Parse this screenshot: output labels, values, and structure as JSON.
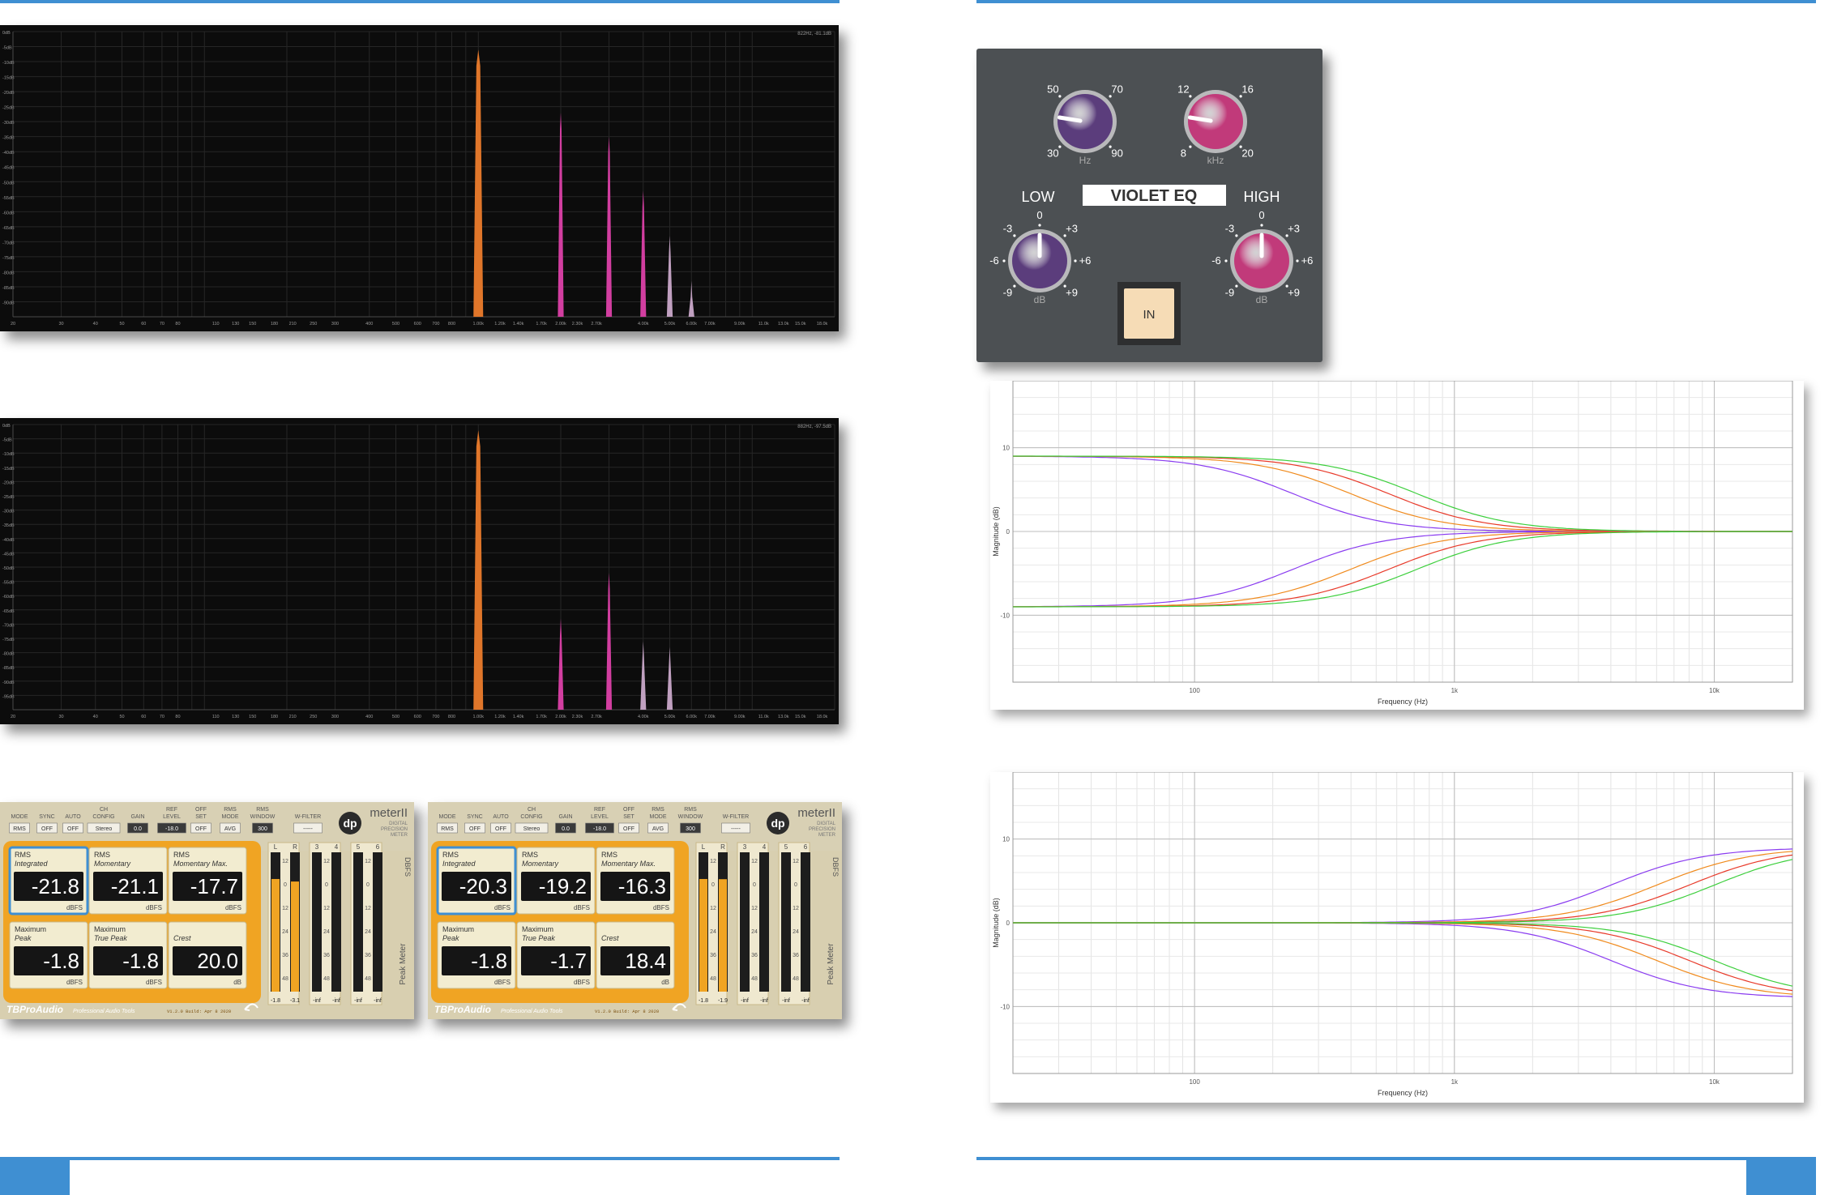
{
  "spectra": [
    {
      "readout": "822Hz, -81.1dB",
      "ylabels": [
        "0dB",
        "-5dB",
        "-10dB",
        "-15dB",
        "-20dB",
        "-25dB",
        "-30dB",
        "-35dB",
        "-40dB",
        "-45dB",
        "-50dB",
        "-55dB",
        "-60dB",
        "-65dB",
        "-70dB",
        "-75dB",
        "-80dB",
        "-85dB",
        "-90dB"
      ],
      "xlabels": [
        "20",
        "30",
        "40",
        "50",
        "60",
        "70",
        "80",
        "110",
        "130",
        "150",
        "180",
        "210",
        "250",
        "300",
        "400",
        "500",
        "600",
        "700",
        "800",
        "1.00k",
        "1.20k",
        "1.40k",
        "1.70k",
        "2.00k",
        "2.30k",
        "2.70k",
        "4.00k",
        "5.00k",
        "6.00k",
        "7.00k",
        "9.00k",
        "11.0k",
        "13.0k",
        "15.0k",
        "18.0k"
      ],
      "peaks": [
        {
          "freq_khz": 1.0,
          "level_db": -6,
          "color": "#e0762a"
        },
        {
          "freq_khz": 2.0,
          "level_db": -27,
          "color": "#d23ea0"
        },
        {
          "freq_khz": 3.0,
          "level_db": -35,
          "color": "#d23ea0"
        },
        {
          "freq_khz": 4.0,
          "level_db": -53,
          "color": "#d23ea0"
        },
        {
          "freq_khz": 5.0,
          "level_db": -68,
          "color": "#c0a0c0"
        },
        {
          "freq_khz": 6.0,
          "level_db": -83,
          "color": "#c0a0c0"
        }
      ]
    },
    {
      "readout": "882Hz, -97.5dB",
      "ylabels": [
        "0dB",
        "-5dB",
        "-10dB",
        "-15dB",
        "-20dB",
        "-25dB",
        "-30dB",
        "-35dB",
        "-40dB",
        "-45dB",
        "-50dB",
        "-55dB",
        "-60dB",
        "-65dB",
        "-70dB",
        "-75dB",
        "-80dB",
        "-85dB",
        "-90dB",
        "-95dB"
      ],
      "xlabels": [
        "20",
        "30",
        "40",
        "50",
        "60",
        "70",
        "80",
        "110",
        "130",
        "150",
        "180",
        "210",
        "250",
        "300",
        "400",
        "500",
        "600",
        "700",
        "800",
        "1.00k",
        "1.20k",
        "1.40k",
        "1.70k",
        "2.00k",
        "2.30k",
        "2.70k",
        "4.00k",
        "5.00k",
        "6.00k",
        "7.00k",
        "9.00k",
        "11.0k",
        "13.0k",
        "15.0k",
        "18.0k"
      ],
      "peaks": [
        {
          "freq_khz": 1.0,
          "level_db": -2,
          "color": "#e0762a"
        },
        {
          "freq_khz": 2.0,
          "level_db": -68,
          "color": "#d23ea0"
        },
        {
          "freq_khz": 3.0,
          "level_db": -52,
          "color": "#d23ea0"
        },
        {
          "freq_khz": 4.0,
          "level_db": -76,
          "color": "#c0a0c0"
        },
        {
          "freq_khz": 5.0,
          "level_db": -78,
          "color": "#c0a0c0"
        }
      ]
    }
  ],
  "meters": [
    {
      "header_labels": [
        "MODE",
        "SYNC",
        "AUTO",
        "CH CONFIG",
        "GAIN",
        "REF LEVEL",
        "OFF SET",
        "RMS MODE",
        "RMS WINDOW",
        "W-FILTER"
      ],
      "header_values": [
        "RMS",
        "OFF",
        "OFF",
        "Stereo",
        "0.0",
        "-18.0",
        "OFF",
        "AVG",
        "300",
        "-----"
      ],
      "logo": "dp",
      "product": "meterII",
      "product_sub": "DIGITAL PRECISION METER",
      "cells": [
        {
          "label1": "RMS",
          "label2": "Integrated",
          "value": "-21.8",
          "unit": "dBFS"
        },
        {
          "label1": "RMS",
          "label2": "Momentary",
          "value": "-21.1",
          "unit": "dBFS"
        },
        {
          "label1": "RMS",
          "label2": "Momentary Max.",
          "value": "-17.7",
          "unit": "dBFS"
        },
        {
          "label1": "Maximum",
          "label2": "Peak",
          "value": "-1.8",
          "unit": "dBFS"
        },
        {
          "label1": "Maximum",
          "label2": "True Peak",
          "value": "-1.8",
          "unit": "dBFS"
        },
        {
          "label1": "",
          "label2": "Crest",
          "value": "20.0",
          "unit": "dB"
        }
      ],
      "ch_labels": [
        "L",
        "R",
        "3",
        "4",
        "5",
        "6"
      ],
      "scale": [
        "12",
        "0",
        "12",
        "24",
        "36",
        "48"
      ],
      "ch_readouts": [
        "-1.8",
        "-3.1",
        "-inf",
        "-inf",
        "-inf",
        "-inf"
      ],
      "side_top": "DBFS",
      "side_bottom": "Peak Meter",
      "brand": "TBProAudio",
      "brand_sub": "Professional Audio Tools",
      "version": "V1.2.0 Build: Apr 8 2020"
    },
    {
      "header_labels": [
        "MODE",
        "SYNC",
        "AUTO",
        "CH CONFIG",
        "GAIN",
        "REF LEVEL",
        "OFF SET",
        "RMS MODE",
        "RMS WINDOW",
        "W-FILTER"
      ],
      "header_values": [
        "RMS",
        "OFF",
        "OFF",
        "Stereo",
        "0.0",
        "-18.0",
        "OFF",
        "AVG",
        "300",
        "-----"
      ],
      "logo": "dp",
      "product": "meterII",
      "product_sub": "DIGITAL PRECISION METER",
      "cells": [
        {
          "label1": "RMS",
          "label2": "Integrated",
          "value": "-20.3",
          "unit": "dBFS"
        },
        {
          "label1": "RMS",
          "label2": "Momentary",
          "value": "-19.2",
          "unit": "dBFS"
        },
        {
          "label1": "RMS",
          "label2": "Momentary Max.",
          "value": "-16.3",
          "unit": "dBFS"
        },
        {
          "label1": "Maximum",
          "label2": "Peak",
          "value": "-1.8",
          "unit": "dBFS"
        },
        {
          "label1": "Maximum",
          "label2": "True Peak",
          "value": "-1.7",
          "unit": "dBFS"
        },
        {
          "label1": "",
          "label2": "Crest",
          "value": "18.4",
          "unit": "dB"
        }
      ],
      "ch_labels": [
        "L",
        "R",
        "3",
        "4",
        "5",
        "6"
      ],
      "scale": [
        "12",
        "0",
        "12",
        "24",
        "36",
        "48"
      ],
      "ch_readouts": [
        "-1.8",
        "-1.9",
        "-inf",
        "-inf",
        "-inf",
        "-inf"
      ],
      "side_top": "DBFS",
      "side_bottom": "Peak Meter",
      "brand": "TBProAudio",
      "brand_sub": "Professional Audio Tools",
      "version": "V1.2.0 Build: Apr 8 2020"
    }
  ],
  "eq": {
    "title": "VIOLET EQ",
    "low_label": "LOW",
    "high_label": "HIGH",
    "in_label": "IN",
    "low_freq": {
      "ticks": [
        "30",
        "50",
        "70",
        "90"
      ],
      "unit": "Hz",
      "color": "#5b3d7c",
      "value": 50
    },
    "high_freq": {
      "ticks": [
        "8",
        "12",
        "16",
        "20"
      ],
      "unit": "kHz",
      "color": "#c13a7a",
      "value": 12
    },
    "low_gain": {
      "ticks": [
        "-9",
        "-6",
        "-3",
        "0",
        "+3",
        "+6",
        "+9"
      ],
      "unit": "dB",
      "color": "#5b3d7c",
      "value": 0
    },
    "high_gain": {
      "ticks": [
        "-9",
        "-6",
        "-3",
        "0",
        "+3",
        "+6",
        "+9"
      ],
      "unit": "dB",
      "color": "#c13a7a",
      "value": 0
    }
  },
  "chart_data": [
    {
      "type": "line",
      "title": "",
      "xlabel": "Frequency (Hz)",
      "ylabel": "Magnitude (dB)",
      "xscale": "log",
      "xlim": [
        20,
        20000
      ],
      "ylim": [
        -18,
        18
      ],
      "yticks": [
        "10",
        "0",
        "-10"
      ],
      "xticks": [
        "100",
        "1k",
        "10k"
      ],
      "curve_shape": "low-shelf",
      "series": [
        {
          "color": "#8a3cf0",
          "corner_hz": 30,
          "gain_db": 9
        },
        {
          "color": "#f08a1c",
          "corner_hz": 50,
          "gain_db": 9
        },
        {
          "color": "#e83a2a",
          "corner_hz": 70,
          "gain_db": 9
        },
        {
          "color": "#3ccf3c",
          "corner_hz": 90,
          "gain_db": 9
        },
        {
          "color": "#8a3cf0",
          "corner_hz": 30,
          "gain_db": -9
        },
        {
          "color": "#f08a1c",
          "corner_hz": 50,
          "gain_db": -9
        },
        {
          "color": "#e83a2a",
          "corner_hz": 70,
          "gain_db": -9
        },
        {
          "color": "#3ccf3c",
          "corner_hz": 90,
          "gain_db": -9
        }
      ]
    },
    {
      "type": "line",
      "title": "",
      "xlabel": "Frequency (Hz)",
      "ylabel": "Magnitude (dB)",
      "xscale": "log",
      "xlim": [
        20,
        20000
      ],
      "ylim": [
        -18,
        18
      ],
      "yticks": [
        "10",
        "0",
        "-10"
      ],
      "xticks": [
        "100",
        "1k",
        "10k"
      ],
      "curve_shape": "high-shelf",
      "series": [
        {
          "color": "#8a3cf0",
          "corner_hz": 8000,
          "gain_db": 9
        },
        {
          "color": "#f08a1c",
          "corner_hz": 12000,
          "gain_db": 9
        },
        {
          "color": "#e83a2a",
          "corner_hz": 16000,
          "gain_db": 9
        },
        {
          "color": "#3ccf3c",
          "corner_hz": 20000,
          "gain_db": 9
        },
        {
          "color": "#8a3cf0",
          "corner_hz": 8000,
          "gain_db": -9
        },
        {
          "color": "#f08a1c",
          "corner_hz": 12000,
          "gain_db": -9
        },
        {
          "color": "#e83a2a",
          "corner_hz": 16000,
          "gain_db": -9
        },
        {
          "color": "#3ccf3c",
          "corner_hz": 20000,
          "gain_db": -9
        }
      ]
    }
  ]
}
